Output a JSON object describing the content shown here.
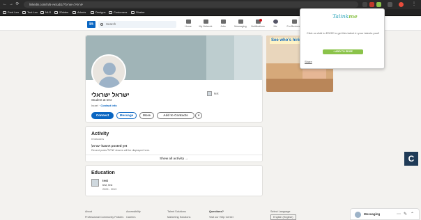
{
  "browser": {
    "url": "linkedin.com/in/צגזאיו-5b1/?יפרופיל=ישראל",
    "bookmarks": [
      "Fred Len",
      "Test Lex",
      "NLG",
      "20ddes",
      "Adonis",
      "Designs",
      "Customers",
      "Shaker"
    ]
  },
  "linkedin": {
    "logo": "in",
    "search_placeholder": "Search",
    "nav": [
      "Home",
      "My Network",
      "Jobs",
      "Messaging",
      "Notifications",
      "Me",
      "For Business"
    ]
  },
  "profile": {
    "name": "ישראל ישראלי",
    "headline": "Student at test",
    "location": "Israel",
    "contact_info": "Contact info",
    "education_mini": "test",
    "buttons": {
      "connect": "Connect",
      "message": "Message",
      "more": "More",
      "add_contacts": "Add to Contacts",
      "dropdown": "▾"
    }
  },
  "activity": {
    "title": "Activity",
    "followers": "0 followers",
    "empty_title": "ישראל hasn't posted yet",
    "empty_sub": "Recent posts ישראל shares will be displayed here.",
    "show_all": "Show all activity →"
  },
  "education": {
    "title": "Education",
    "school": "test",
    "degree": "test, test",
    "years": "2005 - 2013"
  },
  "ad": {
    "headline": "See who's hiring on LinkedIn."
  },
  "popup": {
    "brand_a": "Talink",
    "brand_b": "me",
    "message": "Click on Add to EDGE to get this talent in your talents pool!",
    "add_button": "+ ADD TO EDGE",
    "share": "Share"
  },
  "footer": {
    "col1": [
      "About",
      "Professional Community Policies"
    ],
    "col2": [
      "Accessibility",
      "Careers"
    ],
    "col3": [
      "Talent Solutions",
      "Marketing Solutions"
    ],
    "col4": [
      "Questions?",
      "Visit our Help Center"
    ],
    "col5": [
      "Select Language",
      "English (English)"
    ]
  },
  "messaging": {
    "label": "Messaging",
    "more": "⋯",
    "compose": "✎",
    "collapse": "⌃"
  },
  "floating_c": "C"
}
